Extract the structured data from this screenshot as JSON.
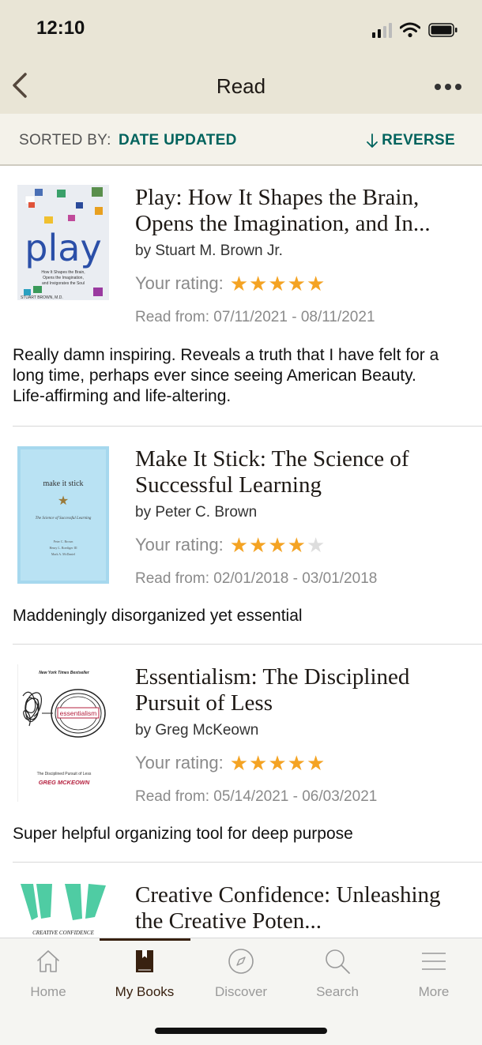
{
  "status_bar": {
    "time": "12:10"
  },
  "nav": {
    "title": "Read",
    "back_icon": "chevron-left-icon",
    "more_icon": "more-horizontal-icon"
  },
  "sort": {
    "label": "SORTED BY:",
    "value": "DATE UPDATED",
    "reverse_label": "REVERSE"
  },
  "books": [
    {
      "title": "Play: How It Shapes the Brain, Opens the Imagination, and In...",
      "author": "by Stuart M. Brown Jr.",
      "rating_label": "Your rating:",
      "rating": 5,
      "read_dates": "Read from: 07/11/2021 - 08/11/2021",
      "review": "Really damn inspiring. Reveals a truth that I have felt for a long time, perhaps ever since seeing American Beauty. Life-affirming and life-altering.",
      "cover": {
        "title": "play",
        "subtitle_lines": [
          "How It Shapes the Brain,",
          "Opens the Imagination,",
          "and Invigorates the Soul"
        ],
        "author": "STUART BROWN, M.D."
      }
    },
    {
      "title": "Make It Stick: The Science of Successful Learning",
      "author": "by Peter C. Brown",
      "rating_label": "Your rating:",
      "rating": 4,
      "read_dates": "Read from: 02/01/2018 - 03/01/2018",
      "review": "Maddeningly disorganized yet essential",
      "cover": {
        "title": "make it stick",
        "subtitle": "The Science of Successful Learning",
        "authors": [
          "Peter C. Brown",
          "Henry L. Roediger III",
          "Mark A. McDaniel"
        ]
      }
    },
    {
      "title": "Essentialism: The Disciplined Pursuit of Less",
      "author": "by Greg McKeown",
      "rating_label": "Your rating:",
      "rating": 5,
      "read_dates": "Read from: 05/14/2021 - 06/03/2021",
      "review": "Super helpful organizing tool for deep purpose",
      "cover": {
        "top": "New York Times Bestseller",
        "title": "essentialism",
        "subtitle": "The Disciplined Pursuit of Less",
        "author": "GREG MCKEOWN"
      }
    },
    {
      "title": "Creative Confidence: Unleashing the Creative Poten...",
      "cover": {
        "title": "CREATIVE CONFIDENCE"
      }
    }
  ],
  "tabs": [
    {
      "label": "Home",
      "icon": "home-icon",
      "active": false
    },
    {
      "label": "My Books",
      "icon": "book-icon",
      "active": true
    },
    {
      "label": "Discover",
      "icon": "compass-icon",
      "active": false
    },
    {
      "label": "Search",
      "icon": "search-icon",
      "active": false
    },
    {
      "label": "More",
      "icon": "menu-icon",
      "active": false
    }
  ],
  "colors": {
    "accent": "#00635d",
    "star": "#f4a323",
    "header_bg": "#e9e5d6",
    "brand_dark": "#382110"
  }
}
